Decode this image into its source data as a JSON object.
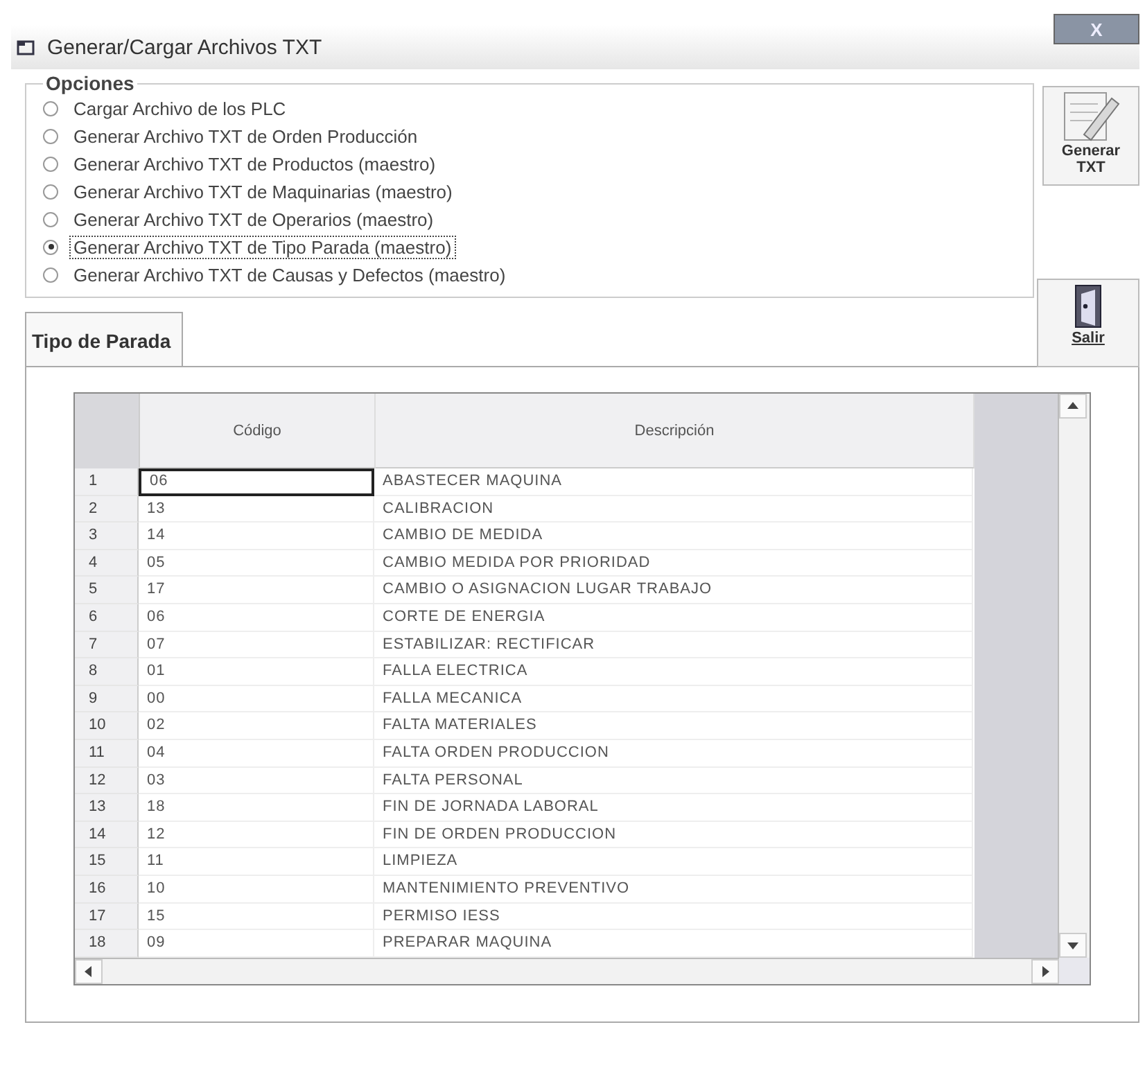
{
  "window": {
    "title": "Generar/Cargar Archivos TXT",
    "close_label": "X"
  },
  "options": {
    "title": "Opciones",
    "items": [
      {
        "label": "Cargar Archivo de los PLC",
        "selected": false
      },
      {
        "label": "Generar Archivo TXT de Orden Producción",
        "selected": false
      },
      {
        "label": "Generar Archivo TXT de Productos (maestro)",
        "selected": false
      },
      {
        "label": "Generar Archivo TXT de Maquinarias (maestro)",
        "selected": false
      },
      {
        "label": "Generar Archivo TXT de Operarios (maestro)",
        "selected": false
      },
      {
        "label": "Generar Archivo TXT de Tipo Parada (maestro)",
        "selected": true
      },
      {
        "label": "Generar Archivo TXT de Causas y Defectos (maestro)",
        "selected": false
      }
    ]
  },
  "buttons": {
    "generate": "Generar TXT",
    "exit": "Salir"
  },
  "tabs": [
    {
      "label": "Tipo de Parada",
      "selected": true
    }
  ],
  "table": {
    "columns": [
      "Código",
      "Descripción"
    ],
    "rows": [
      {
        "num": "1",
        "code": "06",
        "desc": "ABASTECER MAQUINA",
        "selected": true
      },
      {
        "num": "2",
        "code": "13",
        "desc": "CALIBRACION",
        "selected": false
      },
      {
        "num": "3",
        "code": "14",
        "desc": "CAMBIO DE MEDIDA",
        "selected": false
      },
      {
        "num": "4",
        "code": "05",
        "desc": "CAMBIO MEDIDA POR PRIORIDAD",
        "selected": false
      },
      {
        "num": "5",
        "code": "17",
        "desc": "CAMBIO O ASIGNACION LUGAR TRABAJO",
        "selected": false
      },
      {
        "num": "6",
        "code": "06",
        "desc": "CORTE DE ENERGIA",
        "selected": false
      },
      {
        "num": "7",
        "code": "07",
        "desc": "ESTABILIZAR: RECTIFICAR",
        "selected": false
      },
      {
        "num": "8",
        "code": "01",
        "desc": "FALLA ELECTRICA",
        "selected": false
      },
      {
        "num": "9",
        "code": "00",
        "desc": "FALLA MECANICA",
        "selected": false
      },
      {
        "num": "10",
        "code": "02",
        "desc": "FALTA MATERIALES",
        "selected": false
      },
      {
        "num": "11",
        "code": "04",
        "desc": "FALTA ORDEN PRODUCCION",
        "selected": false
      },
      {
        "num": "12",
        "code": "03",
        "desc": "FALTA PERSONAL",
        "selected": false
      },
      {
        "num": "13",
        "code": "18",
        "desc": "FIN DE JORNADA LABORAL",
        "selected": false
      },
      {
        "num": "14",
        "code": "12",
        "desc": "FIN DE ORDEN PRODUCCION",
        "selected": false
      },
      {
        "num": "15",
        "code": "11",
        "desc": "LIMPIEZA",
        "selected": false
      },
      {
        "num": "16",
        "code": "10",
        "desc": "MANTENIMIENTO PREVENTIVO",
        "selected": false
      },
      {
        "num": "17",
        "code": "15",
        "desc": "PERMISO IESS",
        "selected": false
      },
      {
        "num": "18",
        "code": "09",
        "desc": "PREPARAR MAQUINA",
        "selected": false
      }
    ]
  }
}
